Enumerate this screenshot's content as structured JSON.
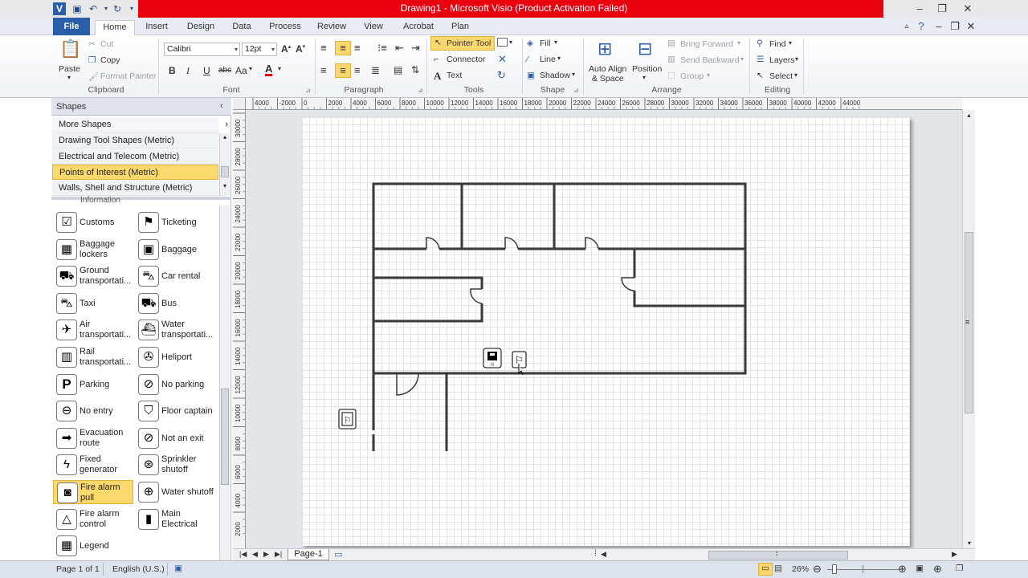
{
  "window": {
    "title": "Drawing1  -  Microsoft Visio (Product Activation Failed)"
  },
  "tabs": [
    "File",
    "Home",
    "Insert",
    "Design",
    "Data",
    "Process",
    "Review",
    "View",
    "Acrobat",
    "Plan"
  ],
  "ribbon": {
    "clipboard": {
      "label": "Clipboard",
      "paste": "Paste",
      "cut": "Cut",
      "copy": "Copy",
      "format_painter": "Format Painter"
    },
    "font": {
      "label": "Font",
      "family": "Calibri",
      "size": "12pt",
      "bold": "B",
      "italic": "I",
      "underline": "U",
      "strike": "abc",
      "case": "Aa",
      "color": "A"
    },
    "paragraph": {
      "label": "Paragraph"
    },
    "tools": {
      "label": "Tools",
      "pointer": "Pointer Tool",
      "connector": "Connector",
      "text": "Text"
    },
    "shape": {
      "label": "Shape",
      "fill": "Fill",
      "line": "Line",
      "shadow": "Shadow"
    },
    "arrange": {
      "label": "Arrange",
      "auto_align_1": "Auto Align",
      "auto_align_2": "& Space",
      "position": "Position",
      "bring_forward": "Bring Forward",
      "send_backward": "Send Backward",
      "group": "Group"
    },
    "editing": {
      "label": "Editing",
      "find": "Find",
      "layers": "Layers",
      "select": "Select"
    }
  },
  "shapes_pane": {
    "title": "Shapes",
    "more_shapes": "More Shapes",
    "stencils": [
      "Drawing Tool Shapes (Metric)",
      "Electrical and Telecom (Metric)",
      "Points of Interest (Metric)",
      "Walls, Shell and Structure (Metric)"
    ],
    "partial_item": "Information",
    "items": [
      [
        "Customs",
        "Ticketing"
      ],
      [
        "Baggage lockers",
        "Baggage"
      ],
      [
        "Ground transportati...",
        "Car rental"
      ],
      [
        "Taxi",
        "Bus"
      ],
      [
        "Air transportati...",
        "Water transportati..."
      ],
      [
        "Rail transportati...",
        "Heliport"
      ],
      [
        "Parking",
        "No parking"
      ],
      [
        "No entry",
        "Floor captain"
      ],
      [
        "Evacuation route",
        "Not an exit"
      ],
      [
        "Fixed generator",
        "Sprinkler shutoff"
      ],
      [
        "Fire alarm pull",
        "Water shutoff"
      ],
      [
        "Fire alarm control",
        "Main Electrical"
      ],
      [
        "Legend",
        ""
      ]
    ]
  },
  "ruler": {
    "h": [
      "4000",
      "-2000",
      "0",
      "2000",
      "4000",
      "6000",
      "8000",
      "10000",
      "12000",
      "14000",
      "16000",
      "18000",
      "20000",
      "22000",
      "24000",
      "26000",
      "28000",
      "30000",
      "32000",
      "34000",
      "36000",
      "38000",
      "40000",
      "42000",
      "44000"
    ],
    "v": [
      "30000",
      "28000",
      "26000",
      "24000",
      "22000",
      "20000",
      "18000",
      "16000",
      "14000",
      "12000",
      "10000",
      "8000",
      "6000",
      "4000",
      "2000"
    ]
  },
  "page_tab": "Page-1",
  "status": {
    "page": "Page 1 of 1",
    "language": "English (U.S.)",
    "zoom": "26%"
  }
}
